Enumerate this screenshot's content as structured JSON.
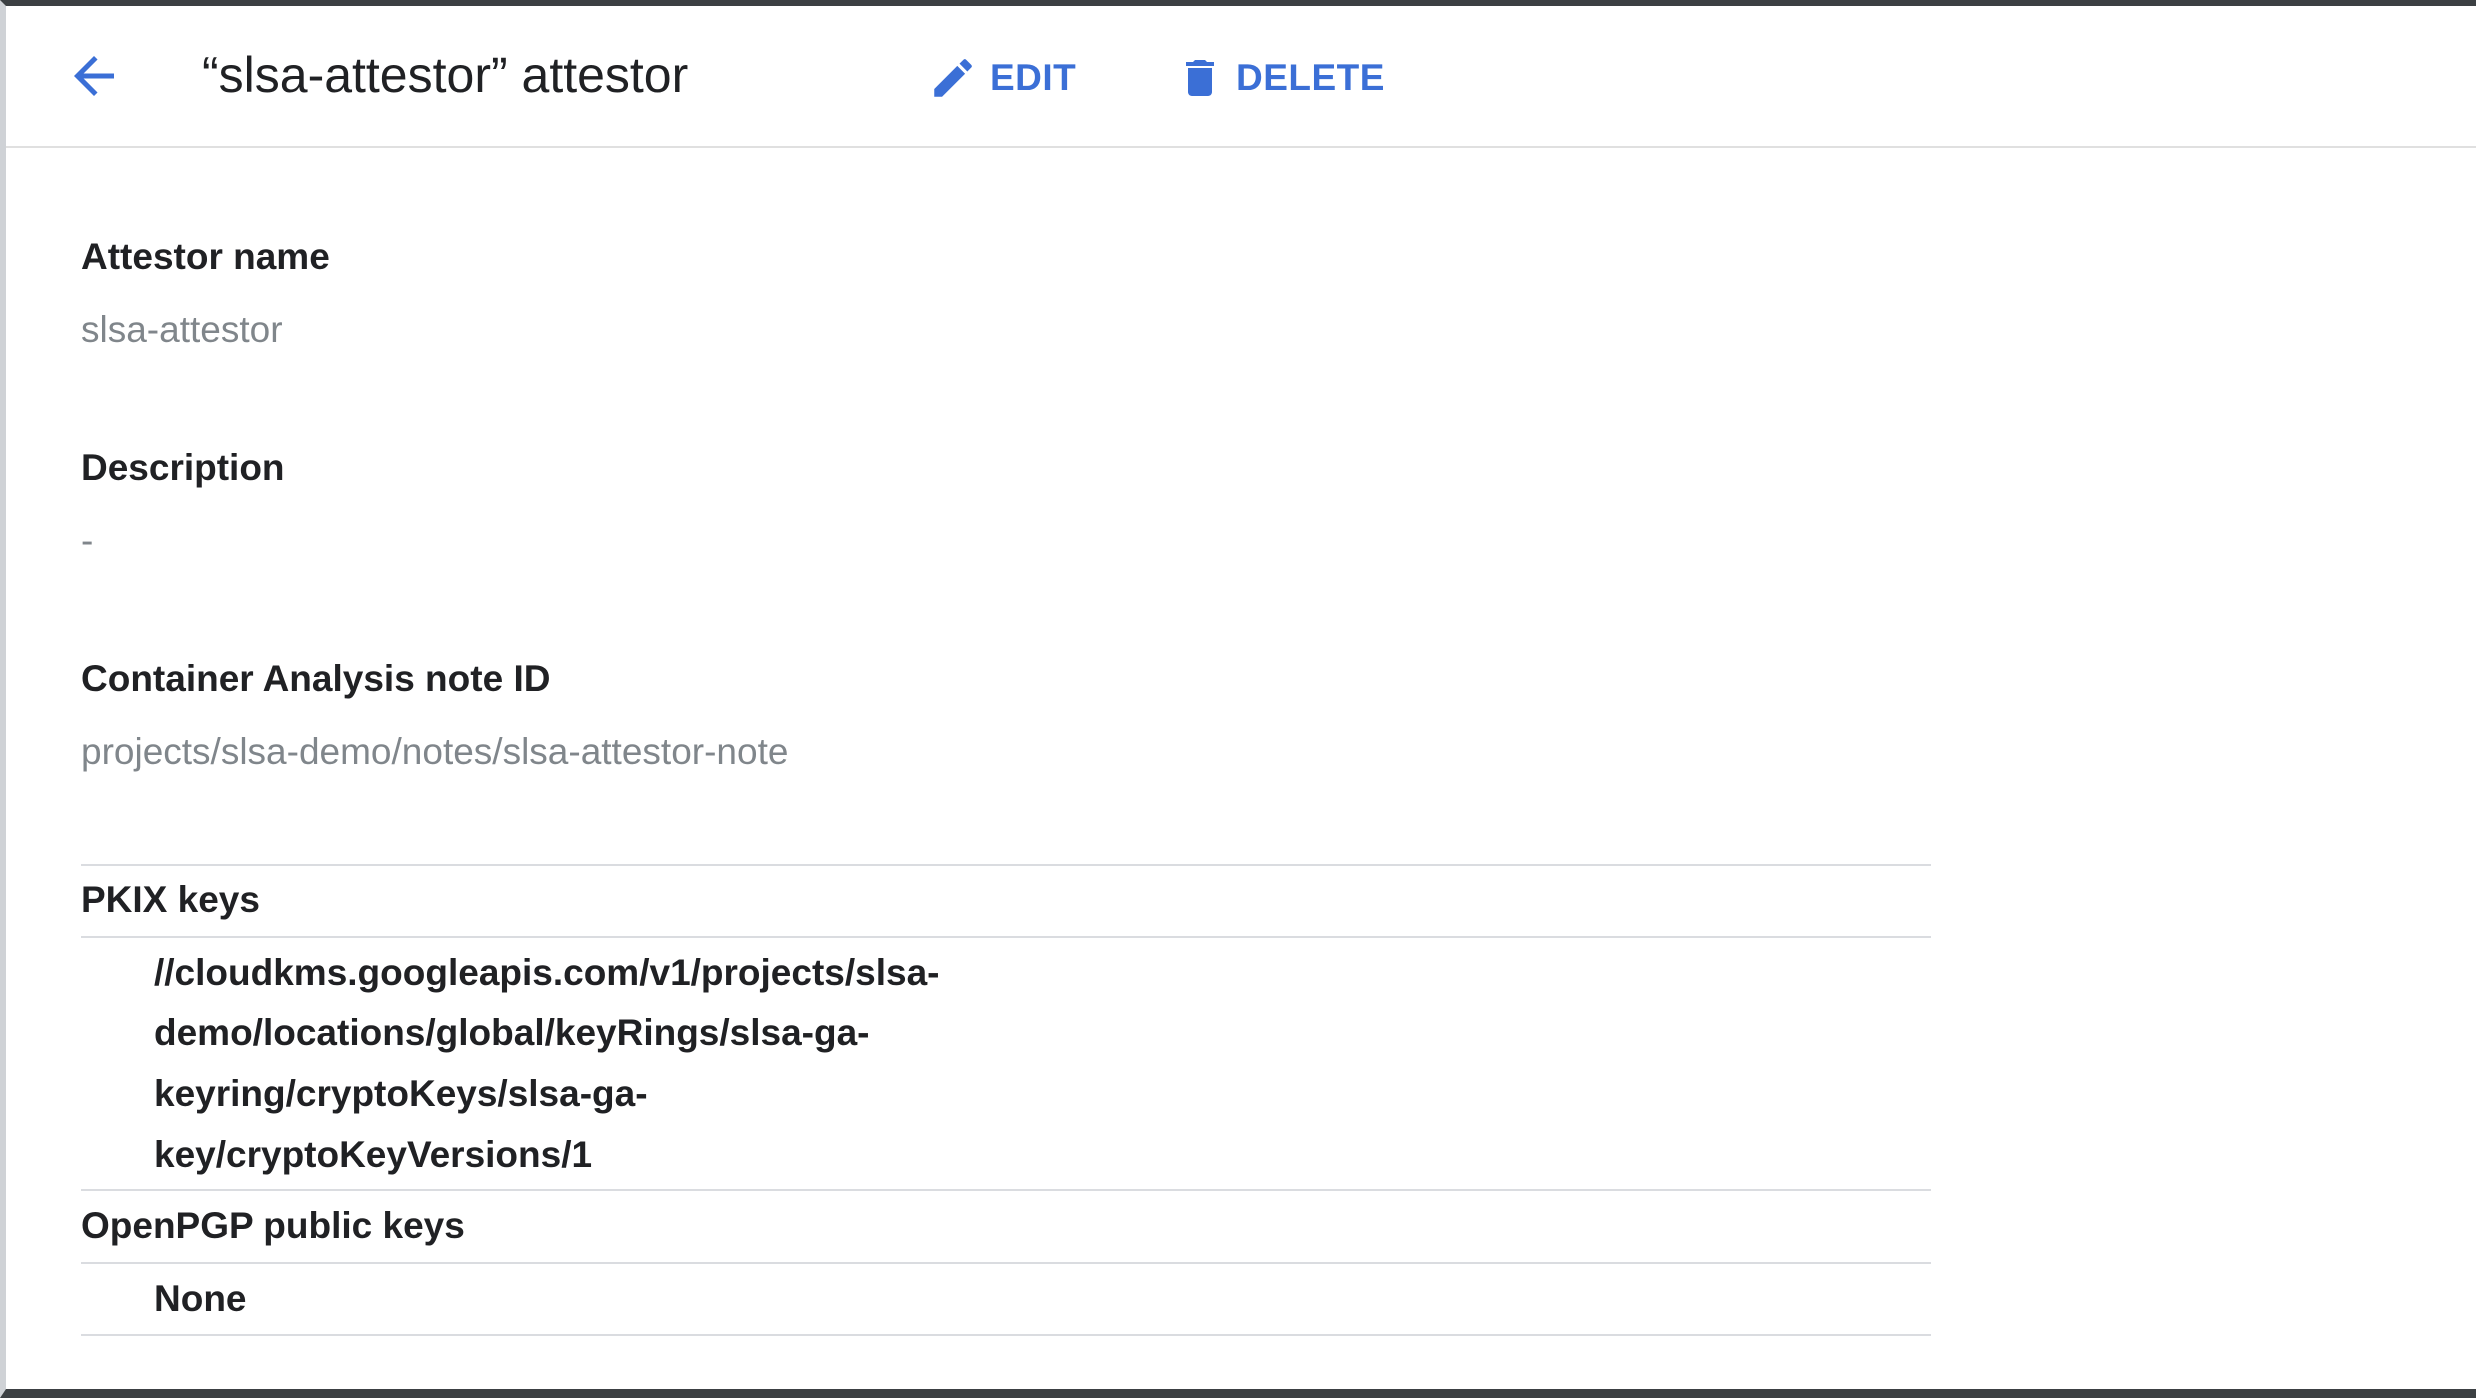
{
  "header": {
    "title": "“slsa-attestor” attestor",
    "edit_label": "EDIT",
    "delete_label": "DELETE",
    "icons": {
      "back": "arrow-back-icon",
      "edit": "pencil-icon",
      "delete": "trash-icon"
    },
    "accent_color": "#3b6fd6"
  },
  "details": {
    "attestor_name": {
      "label": "Attestor name",
      "value": "slsa-attestor"
    },
    "description": {
      "label": "Description",
      "value": "-"
    },
    "note_id": {
      "label": "Container Analysis note ID",
      "value": "projects/slsa-demo/notes/slsa-attestor-note"
    }
  },
  "keys": {
    "pkix": {
      "label": "PKIX keys",
      "lines": [
        "//cloudkms.googleapis.com/v1/projects/slsa-",
        "demo/locations/global/keyRings/slsa-ga-",
        "keyring/cryptoKeys/slsa-ga-",
        "key/cryptoKeyVersions/1"
      ]
    },
    "openpgp": {
      "label": "OpenPGP public keys",
      "value": "None"
    }
  }
}
